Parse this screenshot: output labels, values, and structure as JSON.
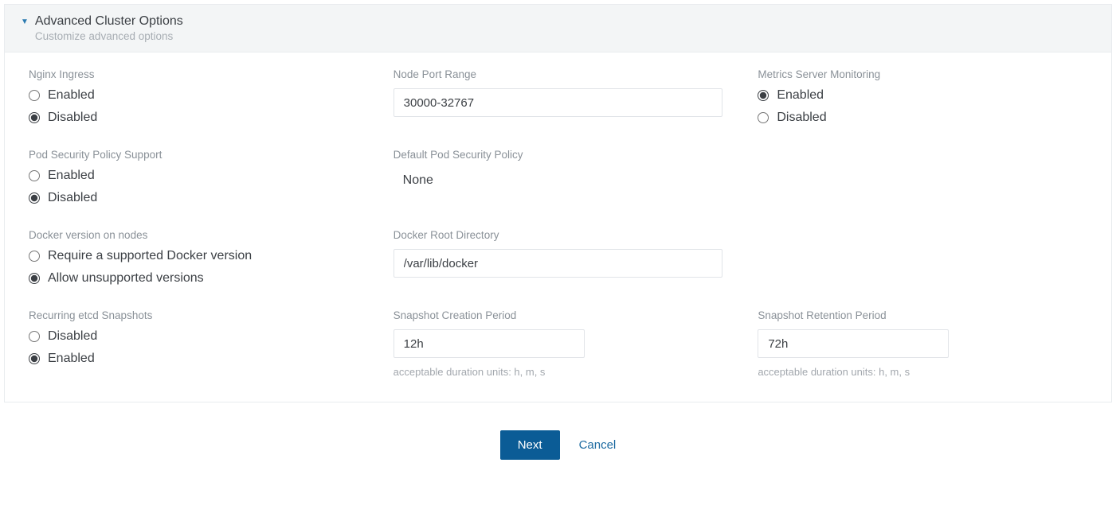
{
  "common": {
    "enabled": "Enabled",
    "disabled": "Disabled"
  },
  "header": {
    "title": "Advanced Cluster Options",
    "subtitle": "Customize advanced options"
  },
  "nginx": {
    "label": "Nginx Ingress",
    "selected": "disabled"
  },
  "nodeport": {
    "label": "Node Port Range",
    "value": "30000-32767"
  },
  "metrics": {
    "label": "Metrics Server Monitoring",
    "selected": "enabled"
  },
  "psp": {
    "label": "Pod Security Policy Support",
    "selected": "disabled"
  },
  "defaultpsp": {
    "label": "Default Pod Security Policy",
    "value": "None"
  },
  "docker": {
    "label": "Docker version on nodes",
    "options": {
      "require": "Require a supported Docker version",
      "allow": "Allow unsupported versions"
    },
    "selected": "allow"
  },
  "dockerroot": {
    "label": "Docker Root Directory",
    "value": "/var/lib/docker"
  },
  "etcd": {
    "label": "Recurring etcd Snapshots",
    "selected": "enabled"
  },
  "snapcreate": {
    "label": "Snapshot Creation Period",
    "value": "12h",
    "help": "acceptable duration units: h, m, s"
  },
  "snapretain": {
    "label": "Snapshot Retention Period",
    "value": "72h",
    "help": "acceptable duration units: h, m, s"
  },
  "footer": {
    "next": "Next",
    "cancel": "Cancel"
  }
}
